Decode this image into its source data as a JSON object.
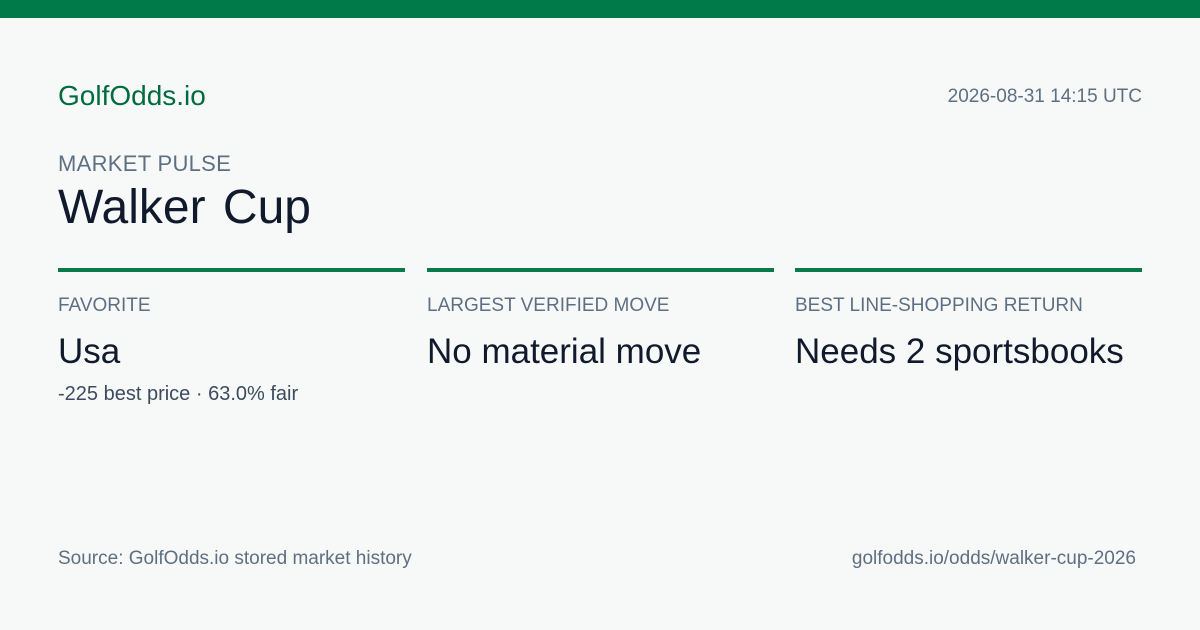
{
  "header": {
    "brand": "GolfOdds.io",
    "timestamp": "2026-08-31 14:15 UTC"
  },
  "hero": {
    "eyebrow": "MARKET PULSE",
    "title": "Walker Cup"
  },
  "stats": [
    {
      "label": "FAVORITE",
      "value": "Usa",
      "sub": "-225 best price · 63.0% fair"
    },
    {
      "label": "LARGEST VERIFIED MOVE",
      "value": "No material move",
      "sub": ""
    },
    {
      "label": "BEST LINE-SHOPPING RETURN",
      "value": "Needs 2 sportsbooks",
      "sub": ""
    }
  ],
  "footer": {
    "source": "Source: GolfOdds.io stored market history",
    "url": "golfodds.io/odds/walker-cup-2026"
  },
  "colors": {
    "accent": "#007a48",
    "background": "#f7f9f8",
    "text": "#111a2c",
    "muted": "#5f6f82"
  }
}
